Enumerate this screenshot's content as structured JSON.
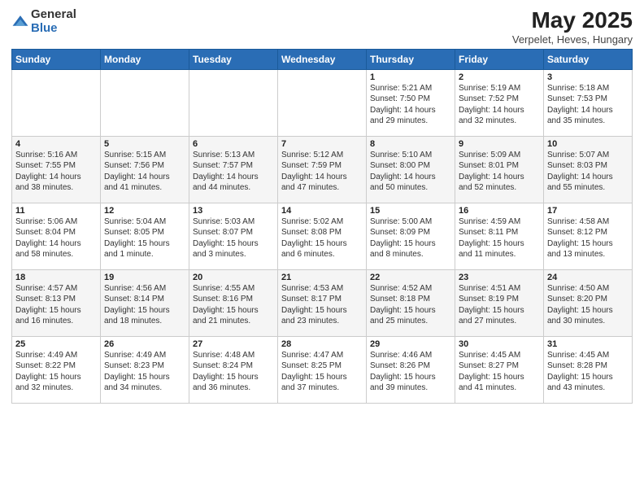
{
  "logo": {
    "general": "General",
    "blue": "Blue"
  },
  "title": "May 2025",
  "subtitle": "Verpelet, Heves, Hungary",
  "days_header": [
    "Sunday",
    "Monday",
    "Tuesday",
    "Wednesday",
    "Thursday",
    "Friday",
    "Saturday"
  ],
  "weeks": [
    [
      {
        "num": "",
        "info": ""
      },
      {
        "num": "",
        "info": ""
      },
      {
        "num": "",
        "info": ""
      },
      {
        "num": "",
        "info": ""
      },
      {
        "num": "1",
        "info": "Sunrise: 5:21 AM\nSunset: 7:50 PM\nDaylight: 14 hours\nand 29 minutes."
      },
      {
        "num": "2",
        "info": "Sunrise: 5:19 AM\nSunset: 7:52 PM\nDaylight: 14 hours\nand 32 minutes."
      },
      {
        "num": "3",
        "info": "Sunrise: 5:18 AM\nSunset: 7:53 PM\nDaylight: 14 hours\nand 35 minutes."
      }
    ],
    [
      {
        "num": "4",
        "info": "Sunrise: 5:16 AM\nSunset: 7:55 PM\nDaylight: 14 hours\nand 38 minutes."
      },
      {
        "num": "5",
        "info": "Sunrise: 5:15 AM\nSunset: 7:56 PM\nDaylight: 14 hours\nand 41 minutes."
      },
      {
        "num": "6",
        "info": "Sunrise: 5:13 AM\nSunset: 7:57 PM\nDaylight: 14 hours\nand 44 minutes."
      },
      {
        "num": "7",
        "info": "Sunrise: 5:12 AM\nSunset: 7:59 PM\nDaylight: 14 hours\nand 47 minutes."
      },
      {
        "num": "8",
        "info": "Sunrise: 5:10 AM\nSunset: 8:00 PM\nDaylight: 14 hours\nand 50 minutes."
      },
      {
        "num": "9",
        "info": "Sunrise: 5:09 AM\nSunset: 8:01 PM\nDaylight: 14 hours\nand 52 minutes."
      },
      {
        "num": "10",
        "info": "Sunrise: 5:07 AM\nSunset: 8:03 PM\nDaylight: 14 hours\nand 55 minutes."
      }
    ],
    [
      {
        "num": "11",
        "info": "Sunrise: 5:06 AM\nSunset: 8:04 PM\nDaylight: 14 hours\nand 58 minutes."
      },
      {
        "num": "12",
        "info": "Sunrise: 5:04 AM\nSunset: 8:05 PM\nDaylight: 15 hours\nand 1 minute."
      },
      {
        "num": "13",
        "info": "Sunrise: 5:03 AM\nSunset: 8:07 PM\nDaylight: 15 hours\nand 3 minutes."
      },
      {
        "num": "14",
        "info": "Sunrise: 5:02 AM\nSunset: 8:08 PM\nDaylight: 15 hours\nand 6 minutes."
      },
      {
        "num": "15",
        "info": "Sunrise: 5:00 AM\nSunset: 8:09 PM\nDaylight: 15 hours\nand 8 minutes."
      },
      {
        "num": "16",
        "info": "Sunrise: 4:59 AM\nSunset: 8:11 PM\nDaylight: 15 hours\nand 11 minutes."
      },
      {
        "num": "17",
        "info": "Sunrise: 4:58 AM\nSunset: 8:12 PM\nDaylight: 15 hours\nand 13 minutes."
      }
    ],
    [
      {
        "num": "18",
        "info": "Sunrise: 4:57 AM\nSunset: 8:13 PM\nDaylight: 15 hours\nand 16 minutes."
      },
      {
        "num": "19",
        "info": "Sunrise: 4:56 AM\nSunset: 8:14 PM\nDaylight: 15 hours\nand 18 minutes."
      },
      {
        "num": "20",
        "info": "Sunrise: 4:55 AM\nSunset: 8:16 PM\nDaylight: 15 hours\nand 21 minutes."
      },
      {
        "num": "21",
        "info": "Sunrise: 4:53 AM\nSunset: 8:17 PM\nDaylight: 15 hours\nand 23 minutes."
      },
      {
        "num": "22",
        "info": "Sunrise: 4:52 AM\nSunset: 8:18 PM\nDaylight: 15 hours\nand 25 minutes."
      },
      {
        "num": "23",
        "info": "Sunrise: 4:51 AM\nSunset: 8:19 PM\nDaylight: 15 hours\nand 27 minutes."
      },
      {
        "num": "24",
        "info": "Sunrise: 4:50 AM\nSunset: 8:20 PM\nDaylight: 15 hours\nand 30 minutes."
      }
    ],
    [
      {
        "num": "25",
        "info": "Sunrise: 4:49 AM\nSunset: 8:22 PM\nDaylight: 15 hours\nand 32 minutes."
      },
      {
        "num": "26",
        "info": "Sunrise: 4:49 AM\nSunset: 8:23 PM\nDaylight: 15 hours\nand 34 minutes."
      },
      {
        "num": "27",
        "info": "Sunrise: 4:48 AM\nSunset: 8:24 PM\nDaylight: 15 hours\nand 36 minutes."
      },
      {
        "num": "28",
        "info": "Sunrise: 4:47 AM\nSunset: 8:25 PM\nDaylight: 15 hours\nand 37 minutes."
      },
      {
        "num": "29",
        "info": "Sunrise: 4:46 AM\nSunset: 8:26 PM\nDaylight: 15 hours\nand 39 minutes."
      },
      {
        "num": "30",
        "info": "Sunrise: 4:45 AM\nSunset: 8:27 PM\nDaylight: 15 hours\nand 41 minutes."
      },
      {
        "num": "31",
        "info": "Sunrise: 4:45 AM\nSunset: 8:28 PM\nDaylight: 15 hours\nand 43 minutes."
      }
    ]
  ]
}
